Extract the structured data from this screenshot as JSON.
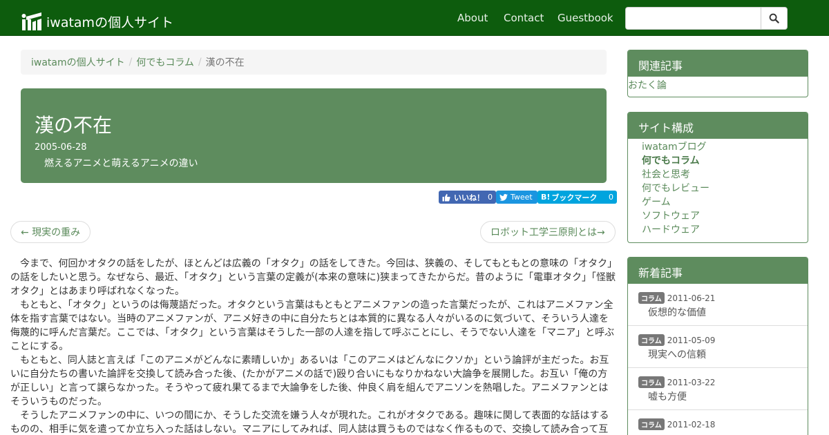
{
  "navbar": {
    "brand": "iwatamの個人サイト",
    "links": [
      "About",
      "Contact",
      "Guestbook"
    ],
    "search_placeholder": ""
  },
  "breadcrumb": {
    "items": [
      "iwatamの個人サイト",
      "何でもコラム"
    ],
    "current": "漢の不在"
  },
  "header": {
    "title": "漢の不在",
    "date": "2005-06-28",
    "subtitle": "燃えるアニメと萌えるアニメの違い"
  },
  "share": {
    "fb_label": "いいね！",
    "fb_count": "0",
    "tw_label": "Tweet",
    "hb_label": "ブックマーク",
    "hb_count": "0"
  },
  "pager": {
    "prev": "← 現実の重み",
    "next": "ロボット工学三原則とは→"
  },
  "article": {
    "paragraphs": [
      "今まで、何回かオタクの話をしたが、ほとんどは広義の「オタク」の話をしてきた。今回は、狭義の、そしてもともとの意味の「オタク」の話をしたいと思う。なぜなら、最近、「オタク」という言葉の定義が(本来の意味に)狭まってきたからだ。昔のように「電車オタク」「怪獣オタク」とはあまり呼ばれなくなった。",
      "もともと、「オタク」というのは侮蔑語だった。オタクという言葉はもともとアニメファンの造った言葉だったが、これはアニメファン全体を指す言葉ではない。当時のアニメファンが、アニメ好きの中に自分たちとは本質的に異なる人々がいるのに気づいて、そういう人達を侮蔑的に呼んだ言葉だ。ここでは、「オタク」という言葉はそうした一部の人達を指して呼ぶことにし、そうでない人達を「マニア」と呼ぶことにする。",
      "もともと、同人誌と言えば「このアニメがどんなに素晴しいか」あるいは「このアニメはどんなにクソか」という論評が主だった。お互いに自分たちの書いた論評を交換して読み合った後、(たかがアニメの話で)殴り合いにもなりかねない大論争を展開した。お互い「俺の方が正しい」と言って譲らなかった。そうやって疲れ果てるまで大論争をした後、仲良く肩を組んでアニソンを熱唱した。アニメファンとはそういうものだった。",
      "そうしたアニメファンの中に、いつの間にか、そうした交流を嫌う人々が現れた。これがオタクである。趣味に関して表面的な話はするものの、相手に気を遣ってか立ち入った話はしない。マニアにしてみれば、同人誌は買うものではなく作るもので、交換して読み合って互"
    ]
  },
  "sidebar": {
    "related": {
      "title": "関連記事",
      "links": [
        "おたく論"
      ]
    },
    "site": {
      "title": "サイト構成",
      "items": [
        "iwatamブログ",
        "何でもコラム",
        "社会と思考",
        "何でもレビュー",
        "ゲーム",
        "ソフトウェア",
        "ハードウェア"
      ],
      "active_index": 1
    },
    "recent": {
      "title": "新着記事",
      "items": [
        {
          "badge": "コラム",
          "date": "2011-06-21",
          "title": "仮想的な価値"
        },
        {
          "badge": "コラム",
          "date": "2011-05-09",
          "title": "現実への信頼"
        },
        {
          "badge": "コラム",
          "date": "2011-03-22",
          "title": "嘘も方便"
        },
        {
          "badge": "コラム",
          "date": "2011-02-18",
          "title": ""
        }
      ]
    }
  },
  "colors": {
    "navbar": "#0d5c0d",
    "accent": "#5e8c5e",
    "link": "#5a8a5a"
  }
}
